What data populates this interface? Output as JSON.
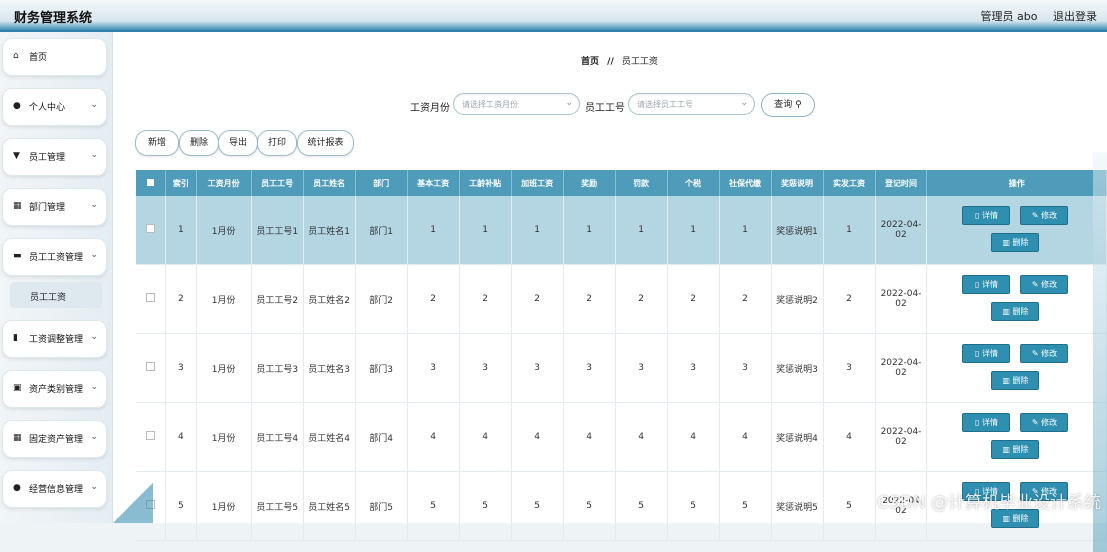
{
  "app": {
    "title": "财务管理系统",
    "user_label": "管理员 abo",
    "logout_label": "退出登录"
  },
  "sidebar": {
    "items": [
      {
        "label": "首页",
        "icon": "home-icon",
        "has_children": false
      },
      {
        "label": "个人中心",
        "icon": "user-icon",
        "has_children": true
      },
      {
        "label": "员工管理",
        "icon": "shield-icon",
        "has_children": true
      },
      {
        "label": "部门管理",
        "icon": "grid-icon",
        "has_children": true
      },
      {
        "label": "员工工资管理",
        "icon": "briefcase-icon",
        "has_children": true
      },
      {
        "label": "工资调整管理",
        "icon": "bar-chart-icon",
        "has_children": true
      },
      {
        "label": "资产类别管理",
        "icon": "clipboard-icon",
        "has_children": true
      },
      {
        "label": "固定资产管理",
        "icon": "grid-icon",
        "has_children": true
      },
      {
        "label": "经营信息管理",
        "icon": "bulb-icon",
        "has_children": true
      }
    ],
    "sub_item": "员工工资"
  },
  "breadcrumb": {
    "home": "首页",
    "sep": "//",
    "current": "员工工资"
  },
  "filters": {
    "month_label": "工资月份",
    "month_placeholder": "请选择工资月份",
    "emp_label": "员工工号",
    "emp_placeholder": "请选择员工工号",
    "query_label": "查询"
  },
  "actions": {
    "add": "新增",
    "delete": "删除",
    "export": "导出",
    "print": "打印",
    "report": "统计报表"
  },
  "table": {
    "headers": [
      "索引",
      "工资月份",
      "员工工号",
      "员工姓名",
      "部门",
      "基本工资",
      "工龄补贴",
      "加班工资",
      "奖励",
      "罚款",
      "个税",
      "社保代缴",
      "奖惩说明",
      "实发工资",
      "登记时间",
      "操作"
    ],
    "rows": [
      {
        "idx": "1",
        "month": "1月份",
        "emp_no": "员工工号1",
        "name": "员工姓名1",
        "dept": "部门1",
        "base": "1",
        "seniority": "1",
        "overtime": "1",
        "bonus": "1",
        "fine": "1",
        "tax": "1",
        "social": "1",
        "note": "奖惩说明1",
        "net": "1",
        "date": "2022-04-02",
        "date_a": "2022-04-",
        "date_b": "02"
      },
      {
        "idx": "2",
        "month": "1月份",
        "emp_no": "员工工号2",
        "name": "员工姓名2",
        "dept": "部门2",
        "base": "2",
        "seniority": "2",
        "overtime": "2",
        "bonus": "2",
        "fine": "2",
        "tax": "2",
        "social": "2",
        "note": "奖惩说明2",
        "net": "2",
        "date_a": "2022-04-",
        "date_b": "02"
      },
      {
        "idx": "3",
        "month": "1月份",
        "emp_no": "员工工号3",
        "name": "员工姓名3",
        "dept": "部门3",
        "base": "3",
        "seniority": "3",
        "overtime": "3",
        "bonus": "3",
        "fine": "3",
        "tax": "3",
        "social": "3",
        "note": "奖惩说明3",
        "net": "3",
        "date_a": "2022-04-",
        "date_b": "02"
      },
      {
        "idx": "4",
        "month": "1月份",
        "emp_no": "员工工号4",
        "name": "员工姓名4",
        "dept": "部门4",
        "base": "4",
        "seniority": "4",
        "overtime": "4",
        "bonus": "4",
        "fine": "4",
        "tax": "4",
        "social": "4",
        "note": "奖惩说明4",
        "net": "4",
        "date_a": "2022-04-",
        "date_b": "02"
      },
      {
        "idx": "5",
        "month": "1月份",
        "emp_no": "员工工号5",
        "name": "员工姓名5",
        "dept": "部门5",
        "base": "5",
        "seniority": "5",
        "overtime": "5",
        "bonus": "5",
        "fine": "5",
        "tax": "5",
        "social": "5",
        "note": "奖惩说明5",
        "net": "5",
        "date_a": "2022-04",
        "date_b": "02"
      }
    ],
    "op_detail": "详情",
    "op_edit": "修改",
    "op_delete": "删除"
  },
  "watermark": "CSDN @计算机毕业设计系统",
  "colors": {
    "header_bg": "#4f9bba",
    "highlight_row": "#b4d5e2",
    "op_button": "#2f8fb0"
  }
}
